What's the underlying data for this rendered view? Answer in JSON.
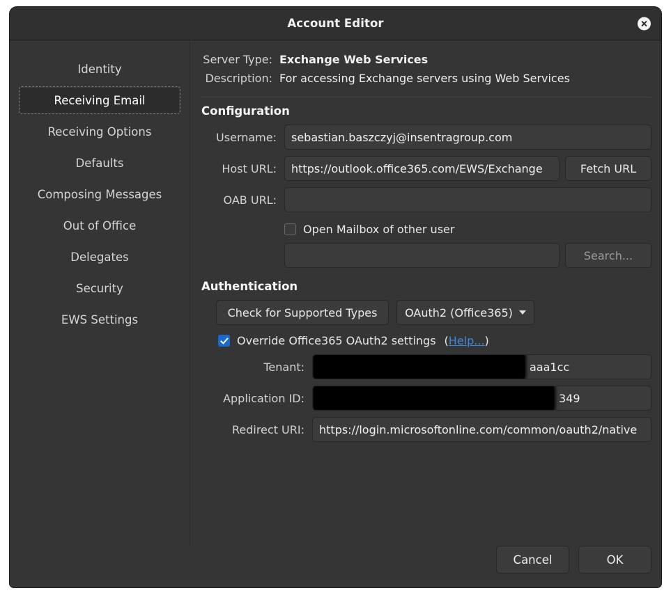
{
  "window": {
    "title": "Account Editor",
    "close_icon": "close-icon"
  },
  "sidebar": {
    "items": [
      {
        "label": "Identity",
        "selected": false
      },
      {
        "label": "Receiving Email",
        "selected": true
      },
      {
        "label": "Receiving Options",
        "selected": false
      },
      {
        "label": "Defaults",
        "selected": false
      },
      {
        "label": "Composing Messages",
        "selected": false
      },
      {
        "label": "Out of Office",
        "selected": false
      },
      {
        "label": "Delegates",
        "selected": false
      },
      {
        "label": "Security",
        "selected": false
      },
      {
        "label": "EWS Settings",
        "selected": false
      }
    ]
  },
  "header": {
    "server_type_label": "Server Type:",
    "server_type_value": "Exchange Web Services",
    "description_label": "Description:",
    "description_value": "For accessing Exchange servers using Web Services"
  },
  "configuration": {
    "title": "Configuration",
    "username_label": "Username:",
    "username_value": "sebastian.baszczyj@insentragroup.com",
    "host_url_label": "Host URL:",
    "host_url_value": "https://outlook.office365.com/EWS/Exchange",
    "fetch_url_label": "Fetch URL",
    "oab_url_label": "OAB URL:",
    "oab_url_value": "",
    "open_mailbox_label": "Open Mailbox of other user",
    "open_mailbox_checked": false,
    "mailbox_user_value": "",
    "search_label": "Search..."
  },
  "authentication": {
    "title": "Authentication",
    "check_types_label": "Check for Supported Types",
    "auth_type_selected": "OAuth2 (Office365)",
    "override_label": "Override Office365 OAuth2 settings",
    "override_checked": true,
    "help_open_paren": "(",
    "help_label": "Help...",
    "help_close_paren": ")",
    "tenant_label": "Tenant:",
    "tenant_value": "aaa1cc",
    "tenant_redacted": true,
    "application_id_label": "Application ID:",
    "application_id_value": "349",
    "application_id_redacted": true,
    "redirect_uri_label": "Redirect URI:",
    "redirect_uri_value": "https://login.microsoftonline.com/common/oauth2/native"
  },
  "footer": {
    "cancel_label": "Cancel",
    "ok_label": "OK"
  },
  "colors": {
    "window_bg": "#353535",
    "titlebar_bg": "#303030",
    "field_bg": "#3b3b3b",
    "accent_blue": "#1b6acb",
    "link_blue": "#3d88e0",
    "redaction": "#000000"
  }
}
